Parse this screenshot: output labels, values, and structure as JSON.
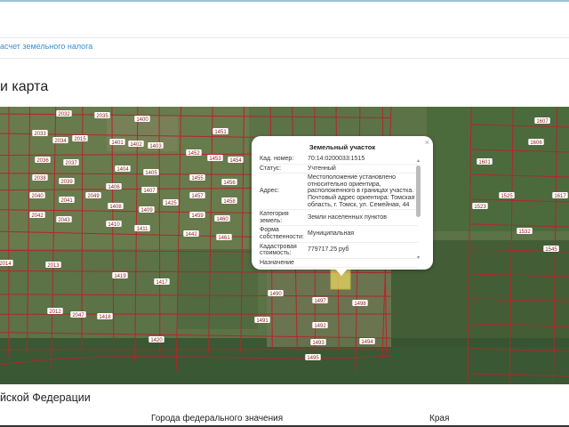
{
  "breadcrumb": {
    "link": "асчет земельного налога"
  },
  "page": {
    "title": "и карта"
  },
  "map": {
    "parcel_color": "#b3262b",
    "selected_color": "#e8d860",
    "labels": [
      "2032",
      "2035",
      "1400",
      "1451",
      "2033",
      "2034",
      "2015",
      "1401",
      "1402",
      "1403",
      "1452",
      "1453",
      "1454",
      "2036",
      "2037",
      "1404",
      "1405",
      "1455",
      "1456",
      "2038",
      "2039",
      "1406",
      "1407",
      "1457",
      "1458",
      "2040",
      "2041",
      "2049",
      "1408",
      "1409",
      "1425",
      "1459",
      "1460",
      "2042",
      "2043",
      "1410",
      "1411",
      "1442",
      "1461",
      "2014",
      "2013",
      "1419",
      "1417",
      "1490",
      "1497",
      "1498",
      "1491",
      "1492",
      "1493",
      "1494",
      "1495",
      "2012",
      "2047",
      "1418",
      "1420",
      "1601",
      "1606",
      "1607",
      "1523",
      "1525",
      "1532",
      "1545",
      "1617"
    ]
  },
  "popup": {
    "title": "Земельный участок",
    "close": "×",
    "rows": [
      {
        "label": "Кад. номер:",
        "value": "70:14:0200033:1515"
      },
      {
        "label": "Статус:",
        "value": "Учтенный"
      },
      {
        "label": "Адрес:",
        "value": "Местоположение установлено относительно ориентира, расположенного в границах участка. Почтовый адрес ориентира: Томская область, г. Томск, ул. Семейная, 44"
      },
      {
        "label": "Категория земель:",
        "value": "Земли населенных пунктов"
      },
      {
        "label": "Форма собственности:",
        "value": "Муниципальная"
      },
      {
        "label": "Кадастровая стоимость:",
        "value": "779717.25 руб"
      },
      {
        "label": "Назначение",
        "value": ""
      }
    ]
  },
  "section": {
    "title": "йской Федерации",
    "columns": [
      "Города федерального значения",
      "Края"
    ]
  }
}
